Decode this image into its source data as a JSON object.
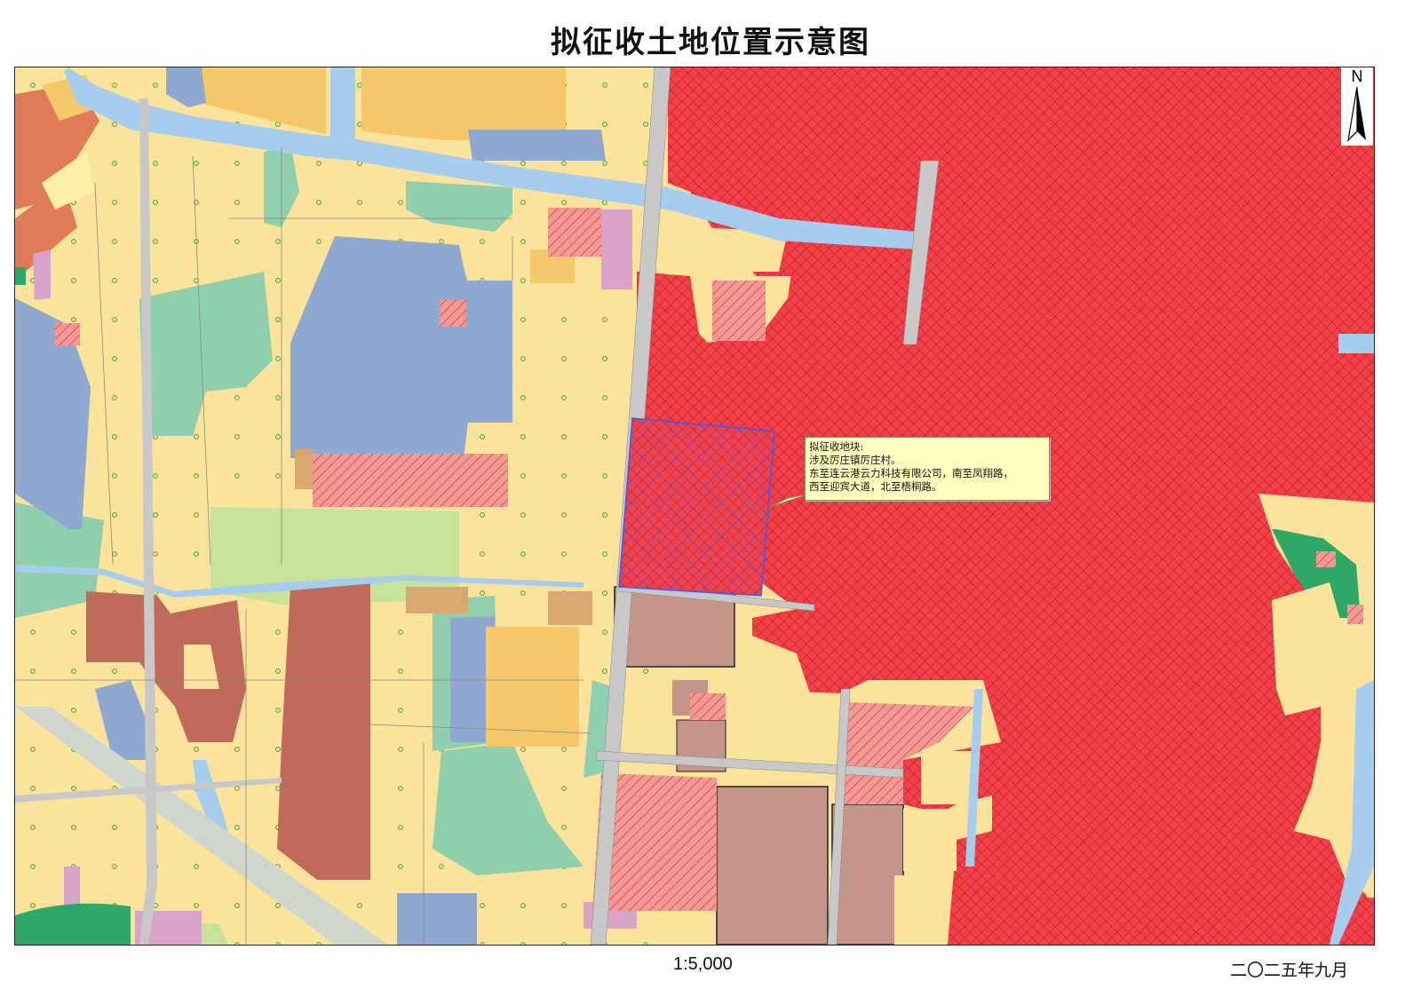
{
  "title": "拟征收土地位置示意图",
  "scale_text": "1:5,000",
  "date_text": "二〇二五年九月",
  "north_label": "N",
  "callout": {
    "line1": "拟征收地块:",
    "line2": "涉及厉庄镇厉庄村。",
    "line3": "东至连云港云力科技有限公司，南至凤翔路，",
    "line4": "西至迎宾大道，北至梧桐路。"
  },
  "colors": {
    "residential_yellow": "#fbe39b",
    "orange_parcel": "#f5c86a",
    "blue_industrial": "#8fa8cf",
    "water": "#a6cdee",
    "green": "#8fcfae",
    "light_green": "#c7e39a",
    "dark_green": "#2ea866",
    "brown": "#c06a5c",
    "taupe": "#c4968a",
    "pink": "#d9a3c9",
    "salmon": "#e07a58",
    "red_crosshatch": "#e8303a",
    "red_hatch": "#f08080",
    "road": "#c8c8c8",
    "parcel_outline": "#3060ff"
  },
  "icons": [
    "north-arrow-icon"
  ]
}
